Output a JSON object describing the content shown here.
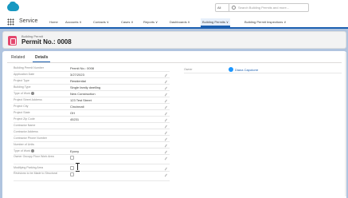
{
  "header": {
    "search_scope": "All",
    "search_placeholder": "Search Building Permits and more..."
  },
  "nav": {
    "app_name": "Service",
    "items": [
      {
        "label": "Home"
      },
      {
        "label": "Accounts ∨"
      },
      {
        "label": "Contacts ∨"
      },
      {
        "label": "Cases ∨"
      },
      {
        "label": "Reports ∨"
      },
      {
        "label": "Dashboards ∨"
      },
      {
        "label": "Building Permits ∨"
      },
      {
        "label": "Building Permit Inspections ∨"
      }
    ]
  },
  "record": {
    "type": "Building Permit",
    "title": "Permit No.: 0008"
  },
  "tabs": [
    {
      "label": "Related"
    },
    {
      "label": "Details"
    }
  ],
  "owner": {
    "label": "Owner",
    "name": "Diana Capotorre"
  },
  "fields": [
    {
      "label": "Building Permit Number",
      "value": "Permit No.: 0008"
    },
    {
      "label": "Application Date",
      "value": "3/27/2023"
    },
    {
      "label": "Project Type",
      "value": "Residential"
    },
    {
      "label": "Building Type",
      "value": "Single family dwelling"
    },
    {
      "label": "Type of Work",
      "value": "New Construction"
    },
    {
      "label": "Project Street Address",
      "value": "123 Test Street"
    },
    {
      "label": "Project City",
      "value": "Cincinnati"
    },
    {
      "label": "Project State",
      "value": "OH"
    },
    {
      "label": "Project Zip Code",
      "value": "45231"
    },
    {
      "label": "Contractor Name",
      "value": ""
    },
    {
      "label": "Contractor Address",
      "value": ""
    },
    {
      "label": "Contractor Phone Number",
      "value": ""
    },
    {
      "label": "Number of Units",
      "value": ""
    },
    {
      "label": "Type of Work",
      "value": "Epoxy"
    },
    {
      "label": "Owner Occupy Floor Work Area",
      "value": ""
    },
    {
      "label": "Modifying Parking Area",
      "value": ""
    },
    {
      "label": "Revisions to be Made to Structural",
      "value": ""
    }
  ]
}
